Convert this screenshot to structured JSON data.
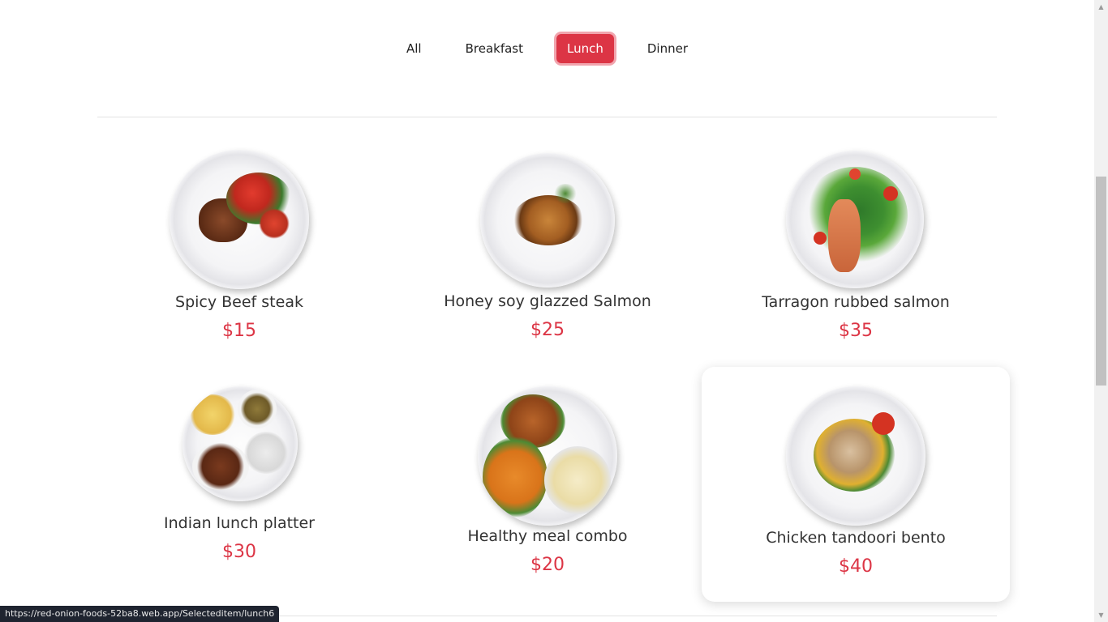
{
  "tabs": [
    {
      "label": "All",
      "active": false
    },
    {
      "label": "Breakfast",
      "active": false
    },
    {
      "label": "Lunch",
      "active": true
    },
    {
      "label": "Dinner",
      "active": false
    }
  ],
  "menu_items": [
    {
      "name": "Spicy Beef steak",
      "price": "$15"
    },
    {
      "name": "Honey soy glazzed Salmon",
      "price": "$25"
    },
    {
      "name": "Tarragon rubbed salmon",
      "price": "$35"
    },
    {
      "name": "Indian lunch platter",
      "price": "$30"
    },
    {
      "name": "Healthy meal combo",
      "price": "$20"
    },
    {
      "name": "Chicken tandoori bento",
      "price": "$40"
    }
  ],
  "status_bar": {
    "url": "https://red-onion-foods-52ba8.web.app/Selecteditem/lunch6"
  },
  "colors": {
    "accent": "#dc3545",
    "price": "#dc3545"
  }
}
